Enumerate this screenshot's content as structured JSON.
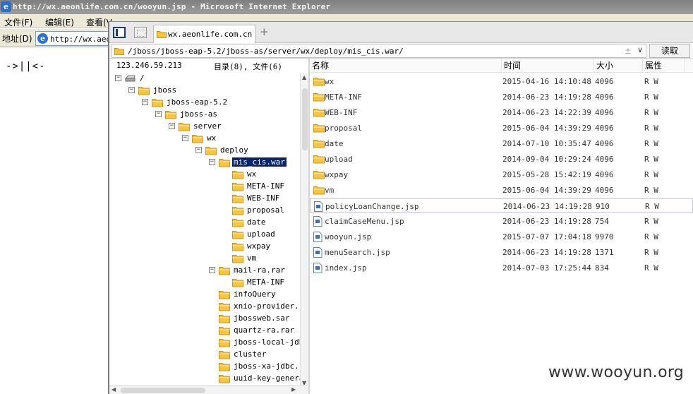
{
  "ie": {
    "title": "http://wx.aeonlife.com.cn/wooyun.jsp - Microsoft Internet Explorer",
    "menu": [
      "文件(F)",
      "编辑(E)",
      "查看(V"
    ],
    "address_label": "地址(D)",
    "address_value": "http://wx.aeon",
    "content_text": "->||<-"
  },
  "shell": {
    "tab_label": "wx.aeonlife.com.cn",
    "add_tab": "+",
    "path": "/jboss/jboss-eap-5.2/jboss-as/server/wx/deploy/mis_cis.war/",
    "path_controls": "±",
    "path_dropdown": "∨",
    "read_button": "读取",
    "ip": "123.246.59.213",
    "counts_dir_label": "目录",
    "counts_dir_value": "(8),",
    "counts_file_label": "文件",
    "counts_file_value": "(6)",
    "tree": [
      {
        "label": "/",
        "level": 0,
        "toggle": "−",
        "icon": "drive"
      },
      {
        "label": "jboss",
        "level": 1,
        "toggle": "−",
        "icon": "folder"
      },
      {
        "label": "jboss-eap-5.2",
        "level": 2,
        "toggle": "−",
        "icon": "folder"
      },
      {
        "label": "jboss-as",
        "level": 3,
        "toggle": "−",
        "icon": "folder"
      },
      {
        "label": "server",
        "level": 4,
        "toggle": "−",
        "icon": "folder"
      },
      {
        "label": "wx",
        "level": 5,
        "toggle": "−",
        "icon": "folder"
      },
      {
        "label": "deploy",
        "level": 6,
        "toggle": "−",
        "icon": "folder"
      },
      {
        "label": "mis_cis.war",
        "level": 7,
        "toggle": "−",
        "icon": "folder",
        "selected": true
      },
      {
        "label": "wx",
        "level": 8,
        "toggle": "",
        "icon": "folder"
      },
      {
        "label": "META-INF",
        "level": 8,
        "toggle": "",
        "icon": "folder"
      },
      {
        "label": "WEB-INF",
        "level": 8,
        "toggle": "",
        "icon": "folder"
      },
      {
        "label": "proposal",
        "level": 8,
        "toggle": "",
        "icon": "folder"
      },
      {
        "label": "date",
        "level": 8,
        "toggle": "",
        "icon": "folder"
      },
      {
        "label": "upload",
        "level": 8,
        "toggle": "",
        "icon": "folder"
      },
      {
        "label": "wxpay",
        "level": 8,
        "toggle": "",
        "icon": "folder"
      },
      {
        "label": "vm",
        "level": 8,
        "toggle": "",
        "icon": "folder"
      },
      {
        "label": "mail-ra.rar",
        "level": 7,
        "toggle": "−",
        "icon": "folder"
      },
      {
        "label": "META-INF",
        "level": 8,
        "toggle": "",
        "icon": "folder"
      },
      {
        "label": "infoQuery",
        "level": 7,
        "toggle": "",
        "icon": "folder"
      },
      {
        "label": "xnio-provider.ja",
        "level": 7,
        "toggle": "",
        "icon": "folder"
      },
      {
        "label": "jbossweb.sar",
        "level": 7,
        "toggle": "",
        "icon": "folder"
      },
      {
        "label": "quartz-ra.rar",
        "level": 7,
        "toggle": "",
        "icon": "folder"
      },
      {
        "label": "jboss-local-jdbc",
        "level": 7,
        "toggle": "",
        "icon": "folder"
      },
      {
        "label": "cluster",
        "level": 7,
        "toggle": "",
        "icon": "folder"
      },
      {
        "label": "jboss-xa-jdbc.ra",
        "level": 7,
        "toggle": "",
        "icon": "folder"
      },
      {
        "label": "uuid-key-generat",
        "level": 7,
        "toggle": "",
        "icon": "folder"
      }
    ],
    "columns": {
      "name": "名称",
      "time": "时间",
      "size": "大小",
      "attr": "属性"
    },
    "files": [
      {
        "name": "wx",
        "time": "2015-04-16 14:10:48",
        "size": "4096",
        "attr": "R W",
        "type": "folder"
      },
      {
        "name": "META-INF",
        "time": "2014-06-23 14:19:28",
        "size": "4096",
        "attr": "R W",
        "type": "folder"
      },
      {
        "name": "WEB-INF",
        "time": "2014-06-23 14:22:39",
        "size": "4096",
        "attr": "R W",
        "type": "folder"
      },
      {
        "name": "proposal",
        "time": "2015-06-04 14:39:29",
        "size": "4096",
        "attr": "R W",
        "type": "folder"
      },
      {
        "name": "date",
        "time": "2014-07-10 10:35:47",
        "size": "4096",
        "attr": "R W",
        "type": "folder"
      },
      {
        "name": "upload",
        "time": "2014-09-04 10:29:24",
        "size": "4096",
        "attr": "R W",
        "type": "folder"
      },
      {
        "name": "wxpay",
        "time": "2015-05-28 15:42:19",
        "size": "4096",
        "attr": "R W",
        "type": "folder"
      },
      {
        "name": "vm",
        "time": "2015-06-04 14:39:29",
        "size": "4096",
        "attr": "R W",
        "type": "folder"
      },
      {
        "name": "policyLoanChange.jsp",
        "time": "2014-06-23 14:19:28",
        "size": "910",
        "attr": "R W",
        "type": "file",
        "highlighted": true
      },
      {
        "name": "claimCaseMenu.jsp",
        "time": "2014-06-23 14:19:28",
        "size": "754",
        "attr": "R W",
        "type": "file"
      },
      {
        "name": "wooyun.jsp",
        "time": "2015-07-07 17:04:18",
        "size": "9970",
        "attr": "R W",
        "type": "file"
      },
      {
        "name": "menuSearch.jsp",
        "time": "2014-06-23 14:19:28",
        "size": "1371",
        "attr": "R W",
        "type": "file"
      },
      {
        "name": "index.jsp",
        "time": "2014-07-03 17:25:44",
        "size": "834",
        "attr": "R W",
        "type": "file"
      }
    ]
  },
  "watermark": "www.wooyun.org",
  "colors": {
    "folder": "#f5c542",
    "folder_edge": "#c8941c",
    "selection": "#0a246a",
    "row_highlight": "#c9c2ea"
  }
}
